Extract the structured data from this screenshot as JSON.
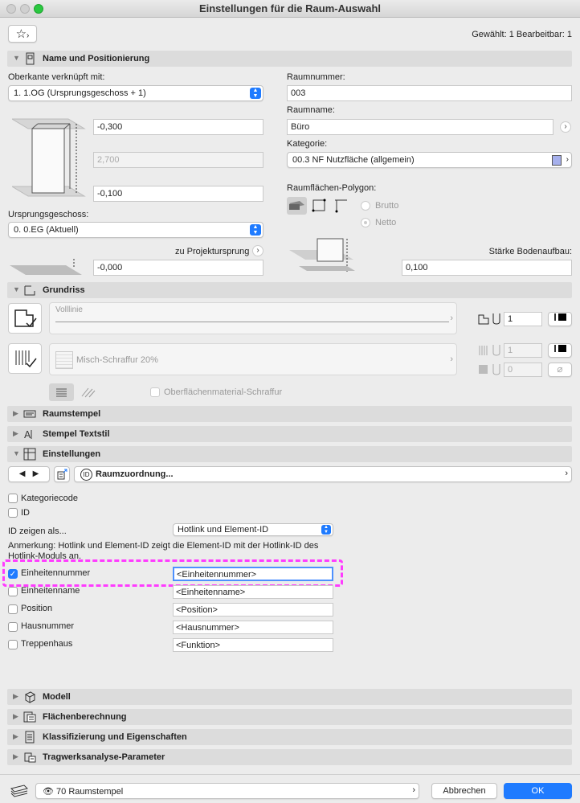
{
  "window": {
    "title": "Einstellungen für die Raum-Auswahl"
  },
  "top": {
    "selection_info": "Gewählt: 1 Bearbeitbar: 1"
  },
  "sections": {
    "name": "Name und Positionierung",
    "grundriss": "Grundriss",
    "raumstempel": "Raumstempel",
    "textstil": "Stempel Textstil",
    "einstellungen": "Einstellungen",
    "modell": "Modell",
    "flaechen": "Flächenberechnung",
    "klass": "Klassifizierung und Eigenschaften",
    "trag": "Tragwerksanalyse-Parameter"
  },
  "positioning": {
    "top_link_label": "Oberkante verknüpft mit:",
    "top_link_value": "1. 1.OG (Ursprungsgeschoss + 1)",
    "top_offset": "-0,300",
    "height": "2,700",
    "bottom_offset": "-0,100",
    "home_story_label": "Ursprungsgeschoss:",
    "home_story_value": "0. 0.EG (Aktuell)",
    "project_zero_label": "zu Projektursprung",
    "project_zero_value": "-0,000",
    "room_number_label": "Raumnummer:",
    "room_number_value": "003",
    "room_name_label": "Raumname:",
    "room_name_value": "Büro",
    "category_label": "Kategorie:",
    "category_value": "00.3 NF Nutzfläche (allgemein)",
    "category_color": "#a6b0ec",
    "polygon_label": "Raumflächen-Polygon:",
    "radio_gross": "Brutto",
    "radio_net": "Netto",
    "floor_thickness_label": "Stärke Bodenaufbau:",
    "floor_thickness_value": "0,100"
  },
  "floorplan": {
    "line_type": "Volllinie",
    "fill_type": "Misch-Schraffur 20%",
    "pen1": "1",
    "pen2": "1",
    "pen3": "0",
    "surface_fill_label": "Oberflächenmaterial-Schraffur"
  },
  "settings": {
    "dropdown": "Raumzuordnung...",
    "cb_category_code": "Kategoriecode",
    "cb_id": "ID",
    "id_show_label": "ID zeigen als...",
    "id_show_value": "Hotlink und Element-ID",
    "note": "Anmerkung: Hotlink und Element-ID zeigt die Element-ID mit der Hotlink-ID des Hotlink-Moduls an.",
    "rows": [
      {
        "label": "Einheitennummer",
        "value": "<Einheitennummer>",
        "checked": true
      },
      {
        "label": "Einheitenname",
        "value": "<Einheitenname>",
        "checked": false
      },
      {
        "label": "Position",
        "value": "<Position>",
        "checked": false
      },
      {
        "label": "Hausnummer",
        "value": "<Hausnummer>",
        "checked": false
      },
      {
        "label": "Treppenhaus",
        "value": "<Funktion>",
        "checked": false
      }
    ]
  },
  "bottom": {
    "stamp_selector": "70 Raumstempel",
    "cancel": "Abbrechen",
    "ok": "OK"
  }
}
